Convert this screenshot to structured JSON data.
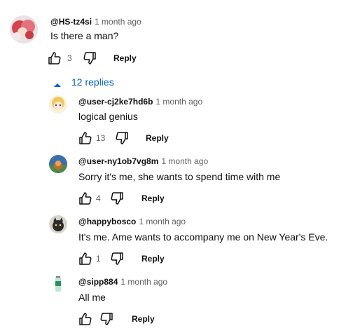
{
  "comment": {
    "author": "@HS-tz4si",
    "time": "1 month ago",
    "text": "Is there a man?",
    "likes": "3",
    "reply_label": "Reply"
  },
  "replies_toggle": {
    "label": "12 replies"
  },
  "replies": [
    {
      "author": "@user-cj2ke7hd6b",
      "time": "1 month ago",
      "text": "logical genius",
      "likes": "13",
      "reply_label": "Reply"
    },
    {
      "author": "@user-ny1ob7vg8m",
      "time": "1 month ago",
      "text": "Sorry it's me, she wants to spend time with me",
      "likes": "4",
      "reply_label": "Reply"
    },
    {
      "author": "@happybosco",
      "time": "1 month ago",
      "text": "It's me. Ame wants to accompany me on New Year's Eve.",
      "likes": "1",
      "reply_label": "Reply"
    },
    {
      "author": "@sipp884",
      "time": "1 month ago",
      "text": "All me",
      "likes": "",
      "reply_label": "Reply"
    }
  ],
  "icons": {
    "like": "thumbs-up-icon",
    "dislike": "thumbs-down-icon",
    "toggle": "caret-up-icon"
  },
  "colors": {
    "link_blue": "#065fd4",
    "secondary_text": "#606060",
    "primary_text": "#0f0f0f"
  }
}
